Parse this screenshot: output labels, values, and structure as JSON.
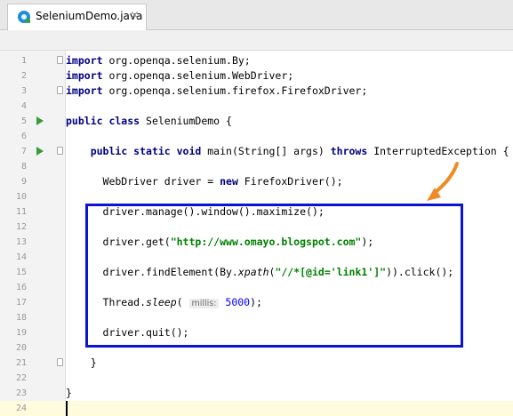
{
  "editor": {
    "tab": {
      "label": "SeleniumDemo.java",
      "close_symbol": "×",
      "icon": "java-class-icon"
    },
    "lines": [
      {
        "n": "1",
        "html": "<span class=\"kw\">import</span> org.openqa.selenium.By;",
        "fold": true
      },
      {
        "n": "2",
        "html": "<span class=\"kw\">import</span> org.openqa.selenium.WebDriver;"
      },
      {
        "n": "3",
        "html": "<span class=\"kw\">import</span> org.openqa.selenium.firefox.FirefoxDriver;",
        "fold": true
      },
      {
        "n": "4",
        "html": ""
      },
      {
        "n": "5",
        "html": "<span class=\"kw\">public class</span> SeleniumDemo {",
        "run": true
      },
      {
        "n": "6",
        "html": ""
      },
      {
        "n": "7",
        "html": "    <span class=\"kw\">public static void</span> main(String[] args) <span class=\"kw\">throws</span> InterruptedException {",
        "run": true,
        "fold": true
      },
      {
        "n": "8",
        "html": ""
      },
      {
        "n": "9",
        "html": "      WebDriver driver = <span class=\"kw\">new</span> FirefoxDriver();"
      },
      {
        "n": "10",
        "html": ""
      },
      {
        "n": "11",
        "html": "      driver.manage().window().maximize();"
      },
      {
        "n": "12",
        "html": ""
      },
      {
        "n": "13",
        "html": "      driver.get(<span class=\"str\">\"http://www.omayo.blogspot.com\"</span>);"
      },
      {
        "n": "14",
        "html": ""
      },
      {
        "n": "15",
        "html": "      driver.findElement(By.<span class=\"it\">xpath</span>(<span class=\"str\">\"//*[@id='link1']\"</span>)).click();"
      },
      {
        "n": "16",
        "html": ""
      },
      {
        "n": "17",
        "html": "      Thread.<span class=\"it\">sleep</span>( <span class=\"hint\">millis:</span> <span class=\"num\">5000</span>);"
      },
      {
        "n": "18",
        "html": ""
      },
      {
        "n": "19",
        "html": "      driver.quit();"
      },
      {
        "n": "20",
        "html": ""
      },
      {
        "n": "21",
        "html": "    }",
        "fold": true
      },
      {
        "n": "22",
        "html": ""
      },
      {
        "n": "23",
        "html": "}"
      },
      {
        "n": "24",
        "html": "",
        "current": true
      }
    ]
  },
  "annotation": {
    "arrow_color": "#f08a24",
    "box_color": "#0a14d2"
  }
}
